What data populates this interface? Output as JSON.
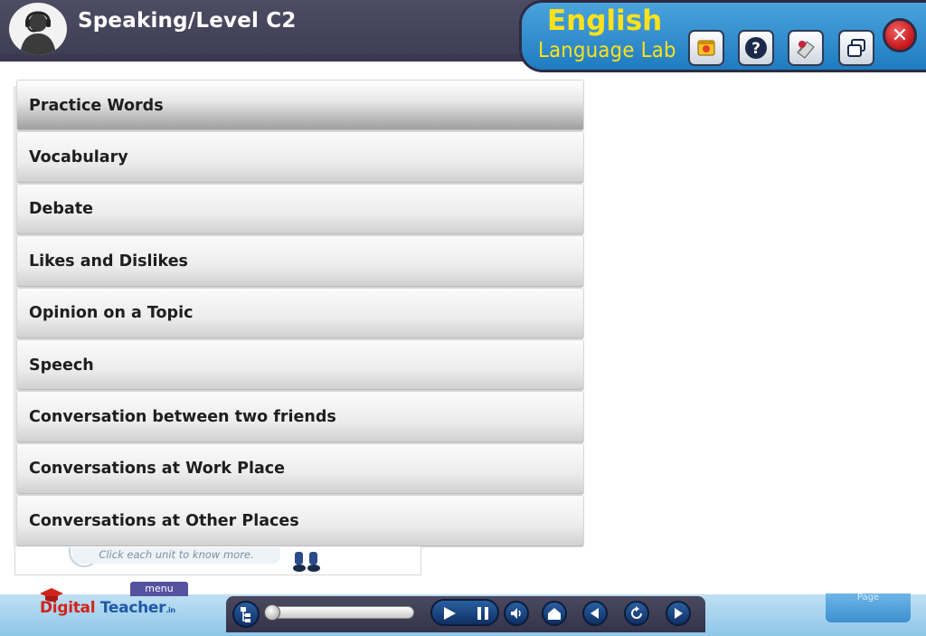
{
  "header": {
    "title": "Speaking/Level C2",
    "brand_english": "English",
    "brand_lab": "Language Lab",
    "close_glyph": "✕"
  },
  "menu": {
    "items": [
      {
        "label": "Practice Words"
      },
      {
        "label": "Vocabulary"
      },
      {
        "label": "Debate"
      },
      {
        "label": "Likes and Dislikes"
      },
      {
        "label": "Opinion on a Topic"
      },
      {
        "label": "Speech"
      },
      {
        "label": "Conversation between two friends"
      },
      {
        "label": "Conversations at Work Place"
      },
      {
        "label": "Conversations at Other Places"
      }
    ],
    "hint": "Click each unit to know more."
  },
  "footer": {
    "menu_tab": "menu",
    "logo_digital": "Digital",
    "logo_teacher": " Teacher",
    "logo_suffix": ".in",
    "page_label": "Page"
  },
  "colors": {
    "header_bg": "#4d4c63",
    "brand_bg": "#2b86c8",
    "brand_text": "#ffe21a",
    "close_red": "#c4141a",
    "control_blue": "#1a4580"
  }
}
